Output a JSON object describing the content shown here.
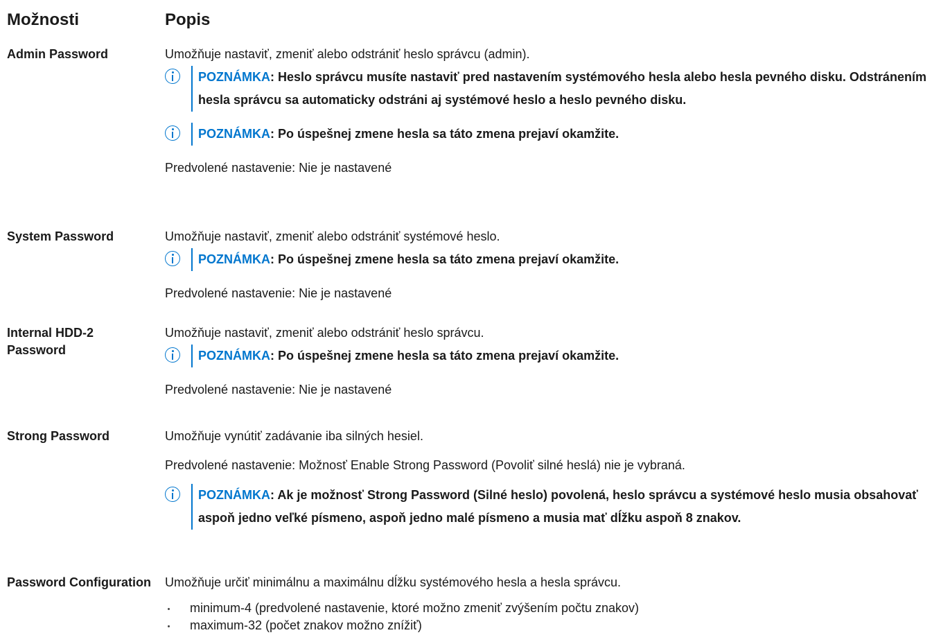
{
  "header": {
    "options": "Možnosti",
    "description": "Popis"
  },
  "note_label": "POZNÁMKA",
  "rows": [
    {
      "option": "Admin Password",
      "text": "Umožňuje nastaviť, zmeniť alebo odstrániť heslo správcu (admin).",
      "note1": ": Heslo správcu musíte nastaviť pred nastavením systémového hesla alebo hesla pevného disku. Odstránením hesla správcu sa automaticky odstráni aj systémové heslo a heslo pevného disku.",
      "note2": ": Po úspešnej zmene hesla sa táto zmena prejaví okamžite.",
      "default": "Predvolené nastavenie: Nie je nastavené"
    },
    {
      "option": "System Password",
      "text": "Umožňuje nastaviť, zmeniť alebo odstrániť systémové heslo.",
      "note1": ": Po úspešnej zmene hesla sa táto zmena prejaví okamžite.",
      "default": "Predvolené nastavenie: Nie je nastavené"
    },
    {
      "option": "Internal HDD-2 Password",
      "text": "Umožňuje nastaviť, zmeniť alebo odstrániť heslo správcu.",
      "note1": ": Po úspešnej zmene hesla sa táto zmena prejaví okamžite.",
      "default": "Predvolené nastavenie: Nie je nastavené"
    },
    {
      "option": "Strong Password",
      "text": "Umožňuje vynútiť zadávanie iba silných hesiel.",
      "default": "Predvolené nastavenie: Možnosť Enable Strong Password (Povoliť silné heslá) nie je vybraná.",
      "note1": ": Ak je možnosť Strong Password (Silné heslo) povolená, heslo správcu a systémové heslo musia obsahovať aspoň jedno veľké písmeno, aspoň jedno malé písmeno a musia mať dĺžku aspoň 8 znakov."
    },
    {
      "option": "Password Configuration",
      "text": "Umožňuje určiť minimálnu a maximálnu dĺžku systémového hesla a hesla správcu.",
      "bullets": [
        "minimum-4 (predvolené nastavenie, ktoré možno zmeniť zvýšením počtu znakov)",
        "maximum-32 (počet znakov možno znížiť)"
      ]
    }
  ]
}
